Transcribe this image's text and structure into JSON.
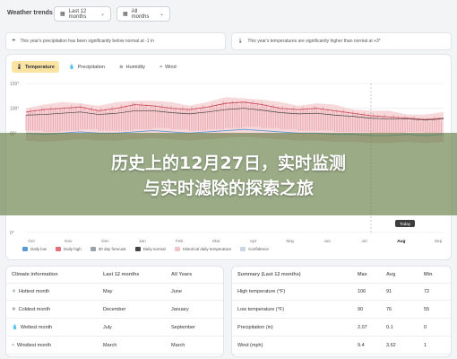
{
  "header": {
    "app_title": "Weather trends",
    "period_select": "Last 12 months",
    "years_select": "All months"
  },
  "banners": [
    {
      "text": "This year's precipitation has been significantly below normal at -1 in"
    },
    {
      "text": "This year's temperatures are significantly higher than normal at +3°"
    }
  ],
  "tabs": [
    {
      "label": "Temperature",
      "active": true
    },
    {
      "label": "Precipitation",
      "active": false
    },
    {
      "label": "Humidity",
      "active": false
    },
    {
      "label": "Wind",
      "active": false
    }
  ],
  "chart_data": {
    "type": "area",
    "y_ticks": [
      "120°",
      "100°",
      "80°",
      "0°"
    ],
    "x_ticks": [
      "Oct",
      "Nov",
      "Dec",
      "Jan",
      "Feb",
      "Mar",
      "Apr",
      "May",
      "Jun",
      "Jul",
      "Aug",
      "Sep"
    ],
    "ylim": [
      0,
      120
    ],
    "grid": true,
    "marker_label": "Today",
    "highlighted_tick": "Aug",
    "series": [
      {
        "name": "Daily high",
        "color": "#e0707a",
        "values": [
          97,
          99,
          100,
          101,
          98,
          100,
          103,
          102,
          100,
          99,
          101,
          104,
          105,
          103,
          100,
          99,
          100,
          98,
          96,
          94,
          93,
          92,
          91,
          92
        ]
      },
      {
        "name": "Daily low",
        "color": "#5a9bd5",
        "values": [
          80,
          79,
          80,
          81,
          80,
          80,
          81,
          82,
          81,
          80,
          81,
          82,
          83,
          82,
          81,
          80,
          80,
          79,
          79,
          78,
          78,
          79,
          78,
          79
        ]
      }
    ]
  },
  "legend": [
    {
      "label": "Daily low",
      "color": "#5a9bd5"
    },
    {
      "label": "Daily high",
      "color": "#e0707a"
    },
    {
      "label": "30 day forecast",
      "color": "#9aa3ad"
    },
    {
      "label": "Daily normal",
      "color": "#444444"
    },
    {
      "label": "Historical daily temperature",
      "color": "#f2c6c9"
    },
    {
      "label": "Confidence",
      "color": "#c9d6e6"
    }
  ],
  "overlay": {
    "line1": "历史上的12月27日，实时监测",
    "line2": "与实时滤除的探索之旅"
  },
  "climate_table": {
    "headers": [
      "Climate information",
      "Last 12 months",
      "All Years"
    ],
    "rows": [
      {
        "icon": "sun-icon",
        "label": "Hottest month",
        "last12": "May",
        "all": "June"
      },
      {
        "icon": "snowflake-icon",
        "label": "Coldest month",
        "last12": "December",
        "all": "January"
      },
      {
        "icon": "drop-icon",
        "label": "Wettest month",
        "last12": "July",
        "all": "September"
      },
      {
        "icon": "wind-icon",
        "label": "Windiest month",
        "last12": "March",
        "all": "March"
      }
    ]
  },
  "summary_table": {
    "headers": [
      "Summary (Last 12 months)",
      "Max",
      "Avg",
      "Min"
    ],
    "rows": [
      {
        "label": "High temperature (°F)",
        "max": "106",
        "avg": "91",
        "min": "72"
      },
      {
        "label": "Low temperature (°F)",
        "max": "90",
        "avg": "76",
        "min": "55"
      },
      {
        "label": "Precipitation (in)",
        "max": "2.07",
        "avg": "0.1",
        "min": "0"
      },
      {
        "label": "Wind (mph)",
        "max": "9.4",
        "avg": "3.62",
        "min": "1"
      }
    ]
  }
}
